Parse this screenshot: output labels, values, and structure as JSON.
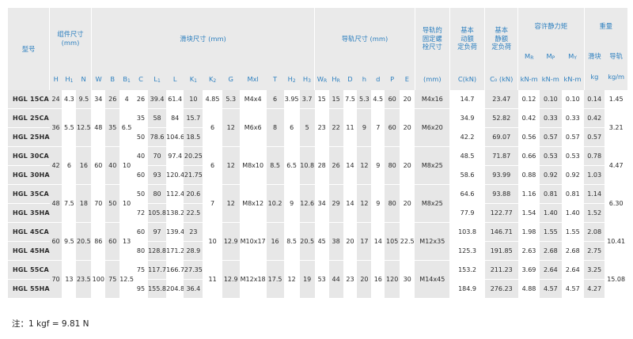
{
  "header": {
    "model": "型号",
    "assembly": "组件尺寸\n(mm)",
    "block": "滑块尺寸 (mm)",
    "rail": "导轨尺寸 (mm)",
    "bolt": "导轨的\n固定螺\n栓尺寸",
    "bolt_unit": "(mm)",
    "dynamic": "基本\n动额\n定负荷",
    "dynamic_unit": "C(kN)",
    "static": "基本\n静额\n定负荷",
    "static_unit": "C₀ (kN)",
    "moment": "容许静力矩",
    "mr": "M",
    "mr_sub": "R",
    "mp": "M",
    "mp_sub": "P",
    "my": "M",
    "my_sub": "Y",
    "moment_unit": "kN-m",
    "weight": "重量",
    "slider": "滑块",
    "slider_unit": "kg",
    "railw": "导轨",
    "railw_unit": "kg/m",
    "cols": [
      "H",
      "H",
      "N",
      "W",
      "B",
      "B",
      "C",
      "L",
      "L",
      "K",
      "K",
      "G",
      "Mxl",
      "T",
      "H",
      "H",
      "W",
      "H",
      "D",
      "h",
      "d",
      "P",
      "E"
    ],
    "subs": [
      "",
      "1",
      "",
      "",
      "",
      "1",
      "",
      "1",
      "",
      "1",
      "2",
      "",
      "",
      "",
      "2",
      "3",
      "R",
      "R",
      "",
      "",
      "",
      "",
      ""
    ]
  },
  "rows": [
    {
      "model": "HGL 15CA",
      "H": "24",
      "H1": "4.3",
      "N": "9.5",
      "W": "34",
      "B": "26",
      "B1": "4",
      "C": "26",
      "L1": "39.4",
      "L": "61.4",
      "K1": "10",
      "K2": "4.85",
      "G": "5.3",
      "Mxl": "M4x4",
      "T": "6",
      "H2": "3.95",
      "H3": "3.7",
      "WR": "15",
      "HR": "15",
      "D": "7.5",
      "h": "5.3",
      "d": "4.5",
      "P": "60",
      "E": "20",
      "bolt": "M4x16",
      "C_dyn": "14.7",
      "C0": "23.47",
      "MR": "0.12",
      "MP": "0.10",
      "MY": "0.10",
      "kg": "0.14",
      "kgm": "1.45"
    },
    {
      "model": "HGL 25CA",
      "C": "35",
      "L1": "58",
      "L": "84",
      "K1": "15.7",
      "C_dyn": "34.9",
      "C0": "52.82",
      "MR": "0.42",
      "MP": "0.33",
      "MY": "0.33",
      "kg": "0.42"
    },
    {
      "model": "HGL 25HA",
      "C": "50",
      "L1": "78.6",
      "L": "104.6",
      "K1": "18.5",
      "C_dyn": "42.2",
      "C0": "69.07",
      "MR": "0.56",
      "MP": "0.57",
      "MY": "0.57",
      "kg": "0.57"
    },
    {
      "model": "HGL 30CA",
      "C": "40",
      "L1": "70",
      "L": "97.4",
      "K1": "20.25",
      "C_dyn": "48.5",
      "C0": "71.87",
      "MR": "0.66",
      "MP": "0.53",
      "MY": "0.53",
      "kg": "0.78"
    },
    {
      "model": "HGL 30HA",
      "C": "60",
      "L1": "93",
      "L": "120.4",
      "K1": "21.75",
      "C_dyn": "58.6",
      "C0": "93.99",
      "MR": "0.88",
      "MP": "0.92",
      "MY": "0.92",
      "kg": "1.03"
    },
    {
      "model": "HGL 35CA",
      "C": "50",
      "L1": "80",
      "L": "112.4",
      "K1": "20.6",
      "C_dyn": "64.6",
      "C0": "93.88",
      "MR": "1.16",
      "MP": "0.81",
      "MY": "0.81",
      "kg": "1.14"
    },
    {
      "model": "HGL 35HA",
      "C": "72",
      "L1": "105.8",
      "L": "138.2",
      "K1": "22.5",
      "C_dyn": "77.9",
      "C0": "122.77",
      "MR": "1.54",
      "MP": "1.40",
      "MY": "1.40",
      "kg": "1.52"
    },
    {
      "model": "HGL 45CA",
      "C": "60",
      "L1": "97",
      "L": "139.4",
      "K1": "23",
      "C_dyn": "103.8",
      "C0": "146.71",
      "MR": "1.98",
      "MP": "1.55",
      "MY": "1.55",
      "kg": "2.08"
    },
    {
      "model": "HGL 45HA",
      "C": "80",
      "L1": "128.8",
      "L": "171.2",
      "K1": "28.9",
      "C_dyn": "125.3",
      "C0": "191.85",
      "MR": "2.63",
      "MP": "2.68",
      "MY": "2.68",
      "kg": "2.75"
    },
    {
      "model": "HGL 55CA",
      "C": "75",
      "L1": "117.7",
      "L": "166.7",
      "K1": "27.35",
      "C_dyn": "153.2",
      "C0": "211.23",
      "MR": "3.69",
      "MP": "2.64",
      "MY": "2.64",
      "kg": "3.25"
    },
    {
      "model": "HGL 55HA",
      "C": "95",
      "L1": "155.8",
      "L": "204.8",
      "K1": "36.4",
      "C_dyn": "184.9",
      "C0": "276.23",
      "MR": "4.88",
      "MP": "4.57",
      "MY": "4.57",
      "kg": "4.27"
    }
  ],
  "groups": [
    {
      "H": "36",
      "H1": "5.5",
      "N": "12.5",
      "W": "48",
      "B": "35",
      "B1": "6.5",
      "K2": "6",
      "G": "12",
      "Mxl": "M6x6",
      "T": "8",
      "H2": "6",
      "H3": "5",
      "WR": "23",
      "HR": "22",
      "D": "11",
      "h": "9",
      "d": "7",
      "P": "60",
      "E": "20",
      "bolt": "M6x20",
      "kgm": "3.21"
    },
    {
      "H": "42",
      "H1": "6",
      "N": "16",
      "W": "60",
      "B": "40",
      "B1": "10",
      "K2": "6",
      "G": "12",
      "Mxl": "M8x10",
      "T": "8.5",
      "H2": "6.5",
      "H3": "10.8",
      "WR": "28",
      "HR": "26",
      "D": "14",
      "h": "12",
      "d": "9",
      "P": "80",
      "E": "20",
      "bolt": "M8x25",
      "kgm": "4.47"
    },
    {
      "H": "48",
      "H1": "7.5",
      "N": "18",
      "W": "70",
      "B": "50",
      "B1": "10",
      "K2": "7",
      "G": "12",
      "Mxl": "M8x12",
      "T": "10.2",
      "H2": "9",
      "H3": "12.6",
      "WR": "34",
      "HR": "29",
      "D": "14",
      "h": "12",
      "d": "9",
      "P": "80",
      "E": "20",
      "bolt": "M8x25",
      "kgm": "6.30"
    },
    {
      "H": "60",
      "H1": "9.5",
      "N": "20.5",
      "W": "86",
      "B": "60",
      "B1": "13",
      "K2": "10",
      "G": "12.9",
      "Mxl": "M10x17",
      "T": "16",
      "H2": "8.5",
      "H3": "20.5",
      "WR": "45",
      "HR": "38",
      "D": "20",
      "h": "17",
      "d": "14",
      "P": "105",
      "E": "22.5",
      "bolt": "M12x35",
      "kgm": "10.41"
    },
    {
      "H": "70",
      "H1": "13",
      "N": "23.5",
      "W": "100",
      "B": "75",
      "B1": "12.5",
      "K2": "11",
      "G": "12.9",
      "Mxl": "M12x18",
      "T": "17.5",
      "H2": "12",
      "H3": "19",
      "WR": "53",
      "HR": "44",
      "D": "23",
      "h": "20",
      "d": "16",
      "P": "120",
      "E": "30",
      "bolt": "M14x45",
      "kgm": "15.08"
    }
  ],
  "note": "注：1 kgf = 9.81 N"
}
